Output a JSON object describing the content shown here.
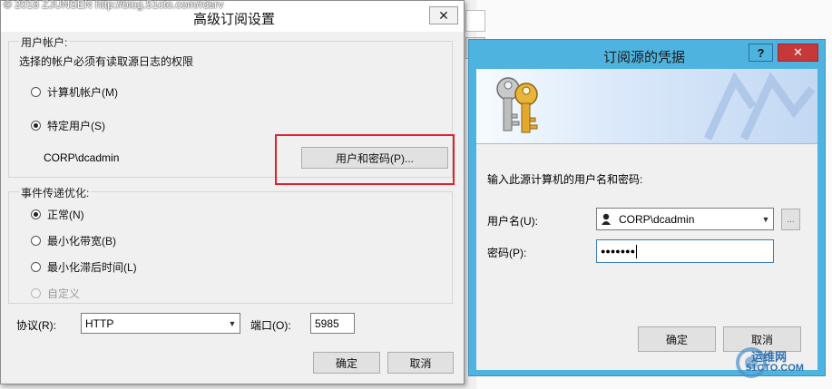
{
  "watermark": "© 2018 ZJUNSEN http://blog.51cto.com/rdsrv",
  "advanced": {
    "title": "高级订阅设置",
    "close_glyph": "✕",
    "account_group": "用户帐户:",
    "account_hint": "选择的帐户必须有读取源日志的权限",
    "radio_machine": "计算机帐户(M)",
    "radio_specific": "特定用户(S)",
    "account_value": "CORP\\dcadmin",
    "user_password_button": "用户和密码(P)...",
    "delivery_group": "事件传递优化:",
    "radio_normal": "正常(N)",
    "radio_min_bandwidth": "最小化带宽(B)",
    "radio_min_latency": "最小化滞后时间(L)",
    "radio_custom": "自定义",
    "protocol_label": "协议(R):",
    "protocol_value": "HTTP",
    "port_label": "端口(O):",
    "port_value": "5985",
    "ok": "确定",
    "cancel": "取消"
  },
  "credentials": {
    "title": "订阅源的凭据",
    "help_glyph": "?",
    "close_glyph": "✕",
    "prompt": "输入此源计算机的用户名和密码:",
    "username_label": "用户名(U):",
    "username_value": "CORP\\dcadmin",
    "browse_glyph": "...",
    "password_label": "密码(P):",
    "password_value": "●●●●●●●",
    "ok": "确定",
    "cancel": "取消"
  },
  "site_logo": {
    "line1": "运维网",
    "line2": "51CTO.COM"
  },
  "colors": {
    "title_blue": "#4fb3e0",
    "highlight_red": "#e0212f"
  }
}
